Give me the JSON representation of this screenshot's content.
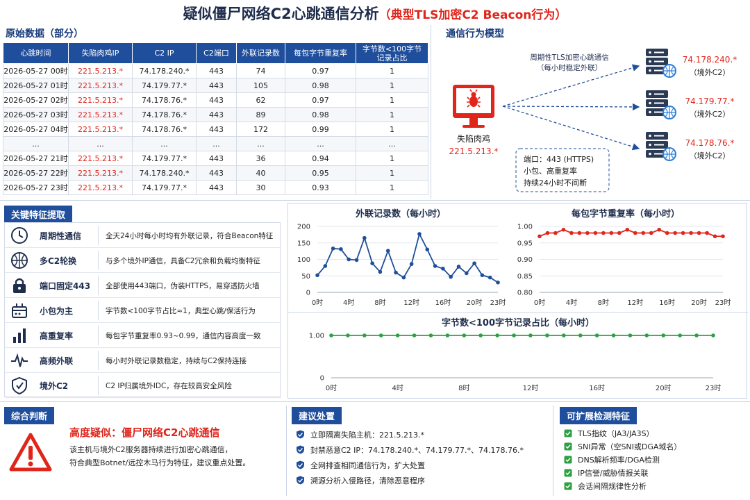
{
  "title": {
    "main": "疑似僵尸网络C2心跳通信分析",
    "sub": "（典型TLS加密C2 Beacon行为）"
  },
  "table_section": {
    "label": "原始数据（部分）",
    "headers": [
      "心跳时间",
      "失陷肉鸡IP",
      "C2 IP",
      "C2端口",
      "外联记录数",
      "每包字节重复率",
      "字节数<100字节\n记录占比"
    ],
    "rows": [
      [
        "2026-05-27 00时",
        "221.5.213.*",
        "74.178.240.*",
        "443",
        "74",
        "0.97",
        "1"
      ],
      [
        "2026-05-27 01时",
        "221.5.213.*",
        "74.179.77.*",
        "443",
        "105",
        "0.98",
        "1"
      ],
      [
        "2026-05-27 02时",
        "221.5.213.*",
        "74.178.76.*",
        "443",
        "62",
        "0.97",
        "1"
      ],
      [
        "2026-05-27 03时",
        "221.5.213.*",
        "74.178.76.*",
        "443",
        "89",
        "0.98",
        "1"
      ],
      [
        "2026-05-27 04时",
        "221.5.213.*",
        "74.178.76.*",
        "443",
        "172",
        "0.99",
        "1"
      ],
      [
        "...",
        "...",
        "...",
        "...",
        "...",
        "...",
        "..."
      ],
      [
        "2026-05-27 21时",
        "221.5.213.*",
        "74.179.77.*",
        "443",
        "36",
        "0.94",
        "1"
      ],
      [
        "2026-05-27 22时",
        "221.5.213.*",
        "74.178.240.*",
        "443",
        "40",
        "0.95",
        "1"
      ],
      [
        "2026-05-27 23时",
        "221.5.213.*",
        "74.179.77.*",
        "443",
        "30",
        "0.93",
        "1"
      ]
    ]
  },
  "model": {
    "label": "通信行为模型",
    "arrow_caption_1": "周期性TLS加密心跳通信",
    "arrow_caption_2": "（每小时稳定外联）",
    "host_name": "失陷肉鸡",
    "host_ip": "221.5.213.*",
    "servers": [
      {
        "ip": "74.178.240.*",
        "tag": "（境外C2）"
      },
      {
        "ip": "74.179.77.*",
        "tag": "（境外C2）"
      },
      {
        "ip": "74.178.76.*",
        "tag": "（境外C2）"
      }
    ],
    "note_1": "端口：443 (HTTPS)",
    "note_2": "小包、高重复率",
    "note_3": "持续24小时不间断",
    "colors": {
      "red": "#e0251b",
      "navy": "#1f4e9c",
      "server": "#2b3a55",
      "globe": "#2f7fd8"
    }
  },
  "features": {
    "label": "关键特征提取",
    "items": [
      {
        "icon": "clock-icon",
        "name": "周期性通信",
        "desc": "全天24小时每小时均有外联记录，符合Beacon特征"
      },
      {
        "icon": "globe-icon",
        "name": "多C2轮换",
        "desc": "与多个境外IP通信，具备C2冗余和负载均衡特征"
      },
      {
        "icon": "lock-icon",
        "name": "端口固定443",
        "desc": "全部使用443端口，伪装HTTPS，易穿透防火墙"
      },
      {
        "icon": "package-icon",
        "name": "小包为主",
        "desc": "字节数<100字节占比≈1，典型心跳/保活行为"
      },
      {
        "icon": "bar-chart-icon",
        "name": "高重复率",
        "desc": "每包字节重复率0.93~0.99，通信内容高度一致"
      },
      {
        "icon": "pulse-icon",
        "name": "高频外联",
        "desc": "每小时外联记录数稳定，持续与C2保持连接"
      },
      {
        "icon": "shield-icon",
        "name": "境外C2",
        "desc": "C2 IP归属境外IDC，存在较高安全风险"
      }
    ]
  },
  "chart_data": [
    {
      "type": "line",
      "title": "外联记录数（每小时）",
      "x": [
        0,
        1,
        2,
        3,
        4,
        5,
        6,
        7,
        8,
        9,
        10,
        11,
        12,
        13,
        14,
        15,
        16,
        17,
        18,
        19,
        20,
        21,
        22,
        23
      ],
      "xticks": [
        "0时",
        "4时",
        "8时",
        "12时",
        "16时",
        "20时",
        "23时"
      ],
      "xtick_values": [
        0,
        4,
        8,
        12,
        16,
        20,
        23
      ],
      "values": [
        52,
        80,
        133,
        131,
        100,
        98,
        165,
        88,
        62,
        126,
        60,
        45,
        86,
        177,
        130,
        80,
        72,
        47,
        78,
        58,
        88,
        52,
        45,
        30
      ],
      "ylim": [
        0,
        200
      ],
      "yticks": [
        "0",
        "50",
        "100",
        "150",
        "200"
      ],
      "ytick_values": [
        0,
        50,
        100,
        150,
        200
      ],
      "color": "#1f4e9c"
    },
    {
      "type": "line",
      "title": "每包字节重复率（每小时）",
      "x": [
        0,
        1,
        2,
        3,
        4,
        5,
        6,
        7,
        8,
        9,
        10,
        11,
        12,
        13,
        14,
        15,
        16,
        17,
        18,
        19,
        20,
        21,
        22,
        23
      ],
      "xticks": [
        "0时",
        "4时",
        "8时",
        "12时",
        "16时",
        "20时",
        "23时"
      ],
      "xtick_values": [
        0,
        4,
        8,
        12,
        16,
        20,
        23
      ],
      "values": [
        0.97,
        0.98,
        0.98,
        0.99,
        0.98,
        0.98,
        0.98,
        0.98,
        0.98,
        0.98,
        0.98,
        0.99,
        0.98,
        0.98,
        0.98,
        0.99,
        0.98,
        0.98,
        0.98,
        0.98,
        0.98,
        0.98,
        0.97,
        0.97
      ],
      "ylim": [
        0.8,
        1.0
      ],
      "yticks": [
        "0.80",
        "0.85",
        "0.90",
        "0.95",
        "1.00"
      ],
      "ytick_values": [
        0.8,
        0.85,
        0.9,
        0.95,
        1.0
      ],
      "color": "#e0251b"
    },
    {
      "type": "line",
      "title": "字节数<100字节记录占比（每小时）",
      "x": [
        0,
        1,
        2,
        3,
        4,
        5,
        6,
        7,
        8,
        9,
        10,
        11,
        12,
        13,
        14,
        15,
        16,
        17,
        18,
        19,
        20,
        21,
        22,
        23
      ],
      "xticks": [
        "0时",
        "4时",
        "8时",
        "12时",
        "16时",
        "20时",
        "23时"
      ],
      "xtick_values": [
        0,
        4,
        8,
        12,
        16,
        20,
        23
      ],
      "values": [
        1,
        1,
        1,
        1,
        1,
        1,
        1,
        1,
        1,
        1,
        1,
        1,
        1,
        1,
        1,
        1,
        1,
        1,
        1,
        1,
        1,
        1,
        1,
        1
      ],
      "ylim": [
        0,
        1.0
      ],
      "yticks": [
        "0",
        "1.00"
      ],
      "ytick_values": [
        0,
        1.0
      ],
      "color": "#2ea043"
    }
  ],
  "judgement": {
    "label": "综合判断",
    "title": "高度疑似：僵尸网络C2心跳通信",
    "line1": "该主机与境外C2服务器持续进行加密心跳通信，",
    "line2": "符合典型Botnet/远控木马行为特征，建议重点处置。"
  },
  "actions": {
    "label": "建议处置",
    "items": [
      "立即隔离失陷主机：221.5.213.*",
      "封禁恶意C2 IP：74.178.240.*、74.179.77.*、74.178.76.*",
      "全网排查相同通信行为，扩大处置",
      "溯源分析入侵路径，清除恶意程序"
    ]
  },
  "extensions": {
    "label": "可扩展检测特征",
    "items": [
      "TLS指纹（JA3/JA3S）",
      "SNI异常（空SNI或DGA域名）",
      "DNS解析频率/DGA检测",
      "IP信誉/威胁情报关联",
      "会话间隔规律性分析"
    ]
  }
}
